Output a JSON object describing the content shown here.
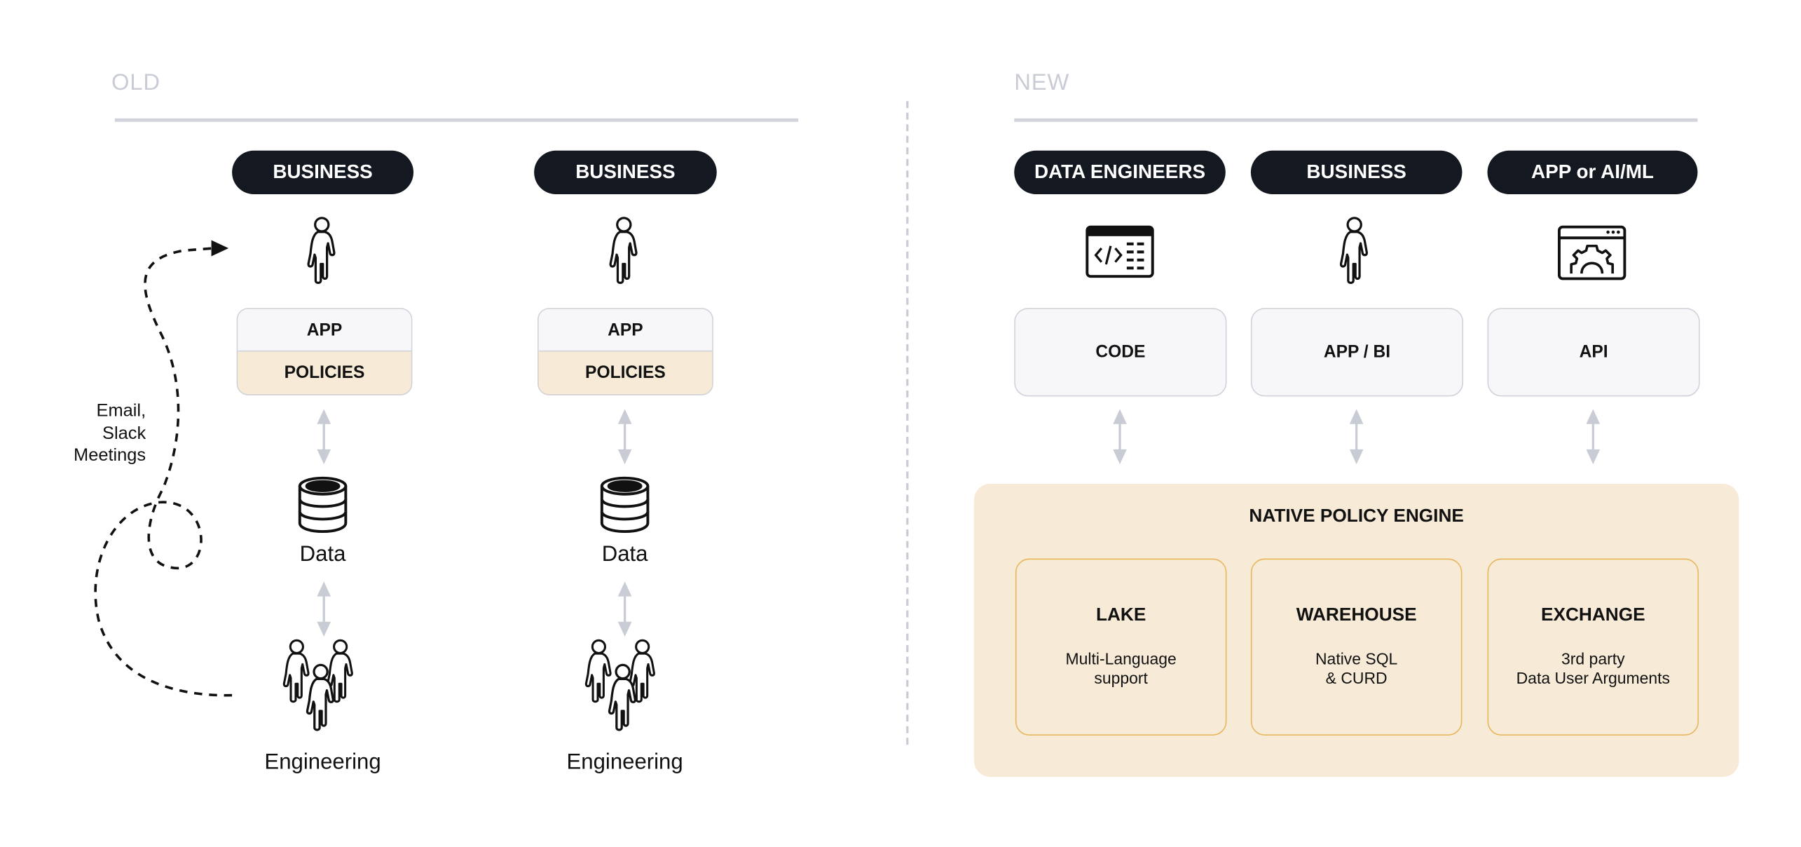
{
  "old": {
    "label": "OLD",
    "columns": [
      {
        "role": "BUSINESS",
        "app": "APP",
        "policies": "POLICIES",
        "data": "Data",
        "team": "Engineering"
      },
      {
        "role": "BUSINESS",
        "app": "APP",
        "policies": "POLICIES",
        "data": "Data",
        "team": "Engineering"
      }
    ],
    "side_note": [
      "Email,",
      "Slack",
      "Meetings"
    ]
  },
  "new": {
    "label": "NEW",
    "columns": [
      {
        "role": "DATA ENGINEERS",
        "icon": "code-window-icon",
        "box": "CODE"
      },
      {
        "role": "BUSINESS",
        "icon": "person-icon",
        "box": "APP / BI"
      },
      {
        "role": "APP or AI/ML",
        "icon": "gear-window-icon",
        "box": "API"
      }
    ],
    "engine": {
      "title": "NATIVE POLICY ENGINE",
      "items": [
        {
          "title": "LAKE",
          "line1": "Multi-Language",
          "line2": "support"
        },
        {
          "title": "WAREHOUSE",
          "line1": "Native SQL",
          "line2": "& CURD"
        },
        {
          "title": "EXCHANGE",
          "line1": "3rd party",
          "line2": "Data User Arguments"
        }
      ]
    }
  },
  "colors": {
    "pill": "#141821",
    "policy_fill": "#f7ebd7",
    "policy_border": "#e8b860",
    "rule": "#d0d3db",
    "arrow": "#c9ccd4"
  }
}
